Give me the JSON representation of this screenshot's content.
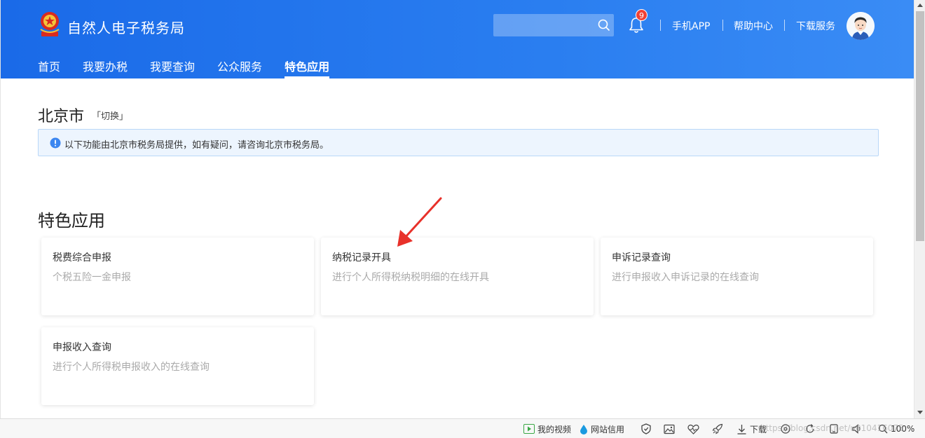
{
  "header": {
    "site_title": "自然人电子税务局",
    "search_placeholder": "",
    "notification_count": "9",
    "links": [
      "手机APP",
      "帮助中心",
      "下载服务"
    ]
  },
  "nav": {
    "items": [
      "首页",
      "我要办税",
      "我要查询",
      "公众服务",
      "特色应用"
    ],
    "active": "特色应用"
  },
  "region": {
    "city": "北京市",
    "switch_label": "「切换」"
  },
  "notice": {
    "text": "以下功能由北京市税务局提供，如有疑问，请咨询北京市税务局。"
  },
  "section": {
    "title": "特色应用",
    "cards": [
      {
        "title": "税费综合申报",
        "desc": "个税五险一金申报"
      },
      {
        "title": "纳税记录开具",
        "desc": "进行个人所得税纳税明细的在线开具"
      },
      {
        "title": "申诉记录查询",
        "desc": "进行申报收入申诉记录的在线查询"
      },
      {
        "title": "申报收入查询",
        "desc": "进行个人所得税申报收入的在线查询"
      }
    ]
  },
  "statusbar": {
    "my_video": "我的视频",
    "site_credit": "网站信用",
    "download": "下载",
    "zoom": "100%",
    "watermark": "https://blog.csdn.net/u010416075"
  },
  "colors": {
    "header_blue": "#1a6ae8",
    "badge_red": "#f04134",
    "notice_bg": "#edf5fe",
    "arrow_red": "#e8312a"
  }
}
